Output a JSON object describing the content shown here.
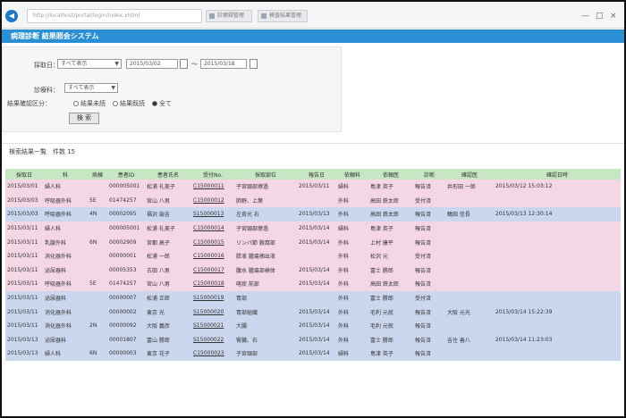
{
  "browser": {
    "url": "http://localhost/portal/login/index.xhtml",
    "tabs": [
      {
        "label": "診療録管理"
      },
      {
        "label": "検査結果管理"
      }
    ],
    "minimize": "—",
    "maximize": "□",
    "close": "×"
  },
  "app": {
    "title": "病理診断 結果照会システム"
  },
  "search": {
    "dept_label": "診療科：",
    "dept_value": "すべて表示",
    "date_label": "採取日：",
    "date_option": "すべて表示",
    "date_from": "2015/03/02",
    "date_to": "2015/03/18",
    "tilde": "～",
    "confirm_label": "結果確認区分：",
    "radio_unconfirmed": "結果未読",
    "radio_confirmed": "結果既読",
    "radio_all": "全て",
    "search_button": "検 索"
  },
  "results": {
    "title": "検索結果一覧　件数 15",
    "headers": [
      "採取日",
      "科",
      "病棟",
      "患者ID",
      "患者氏名",
      "受付No.",
      "採取部位",
      "報告日",
      "依頼科",
      "依頼医",
      "医師",
      "診断",
      "確認医",
      "確認日時"
    ],
    "rows": [
      {
        "color": "pink",
        "cells": [
          "2015/03/01",
          "婦人科",
          "",
          "000005001",
          "松浦 礼美子",
          "C15000011",
          "子宮頸部擦過",
          "2015/03/11",
          "婦科",
          "島津 英子",
          "報告済",
          "井形田 一郎",
          "2015/03/12 15:03:12"
        ]
      },
      {
        "color": "pink",
        "cells": [
          "2015/03/03",
          "呼吸器外科",
          "5E",
          "01474257",
          "宮山 八男",
          "C15000012",
          "肺野、上葉",
          "",
          "外科",
          "高田 鉄太郎",
          "受付済",
          "",
          ""
        ]
      },
      {
        "color": "blue",
        "cells": [
          "2015/03/03",
          "呼吸器外科",
          "4N",
          "00002095",
          "福沢 諭吉",
          "S15000013",
          "左背光 右",
          "2015/03/13",
          "外科",
          "高田 鉄太郎",
          "報告済",
          "鶴田 信長",
          "2015/03/13 12:30:14"
        ]
      },
      {
        "color": "pink",
        "cells": [
          "2015/03/11",
          "婦人科",
          "",
          "000005001",
          "松浦 礼美子",
          "C15000014",
          "子宮頸部擦過",
          "2015/03/14",
          "婦科",
          "島津 英子",
          "報告済",
          "",
          ""
        ]
      },
      {
        "color": "pink",
        "cells": [
          "2015/03/11",
          "乳腺外科",
          "6N",
          "00002909",
          "宮都 高子",
          "C15000015",
          "リンパ節 腋窩部",
          "2015/03/14",
          "外科",
          "上村 康平",
          "報告済",
          "",
          ""
        ]
      },
      {
        "color": "pink",
        "cells": [
          "2015/03/11",
          "消化器外科",
          "",
          "00000001",
          "松浦 一郎",
          "C15000016",
          "膵液 腫瘍摘出液",
          "",
          "外科",
          "松沢 元",
          "受付済",
          "",
          ""
        ]
      },
      {
        "color": "pink",
        "cells": [
          "2015/03/11",
          "泌尿器科",
          "",
          "00005353",
          "古田 八男",
          "C15000017",
          "腹水 腫瘍部検体",
          "2015/03/14",
          "外科",
          "富士 勝郎",
          "報告済",
          "",
          ""
        ]
      },
      {
        "color": "pink",
        "cells": [
          "2015/03/11",
          "呼吸器外科",
          "5E",
          "01474257",
          "宮山 八男",
          "C15000018",
          "喀痰 前部",
          "2015/03/14",
          "外科",
          "高田 鉄太郎",
          "報告済",
          "",
          ""
        ]
      },
      {
        "color": "blue",
        "cells": [
          "2015/03/11",
          "泌尿器科",
          "",
          "00000007",
          "松浦 正郎",
          "S15000019",
          "胃部",
          "",
          "外科",
          "富士 勝郎",
          "受付済",
          "",
          ""
        ]
      },
      {
        "color": "blue",
        "cells": [
          "2015/03/11",
          "消化器外科",
          "",
          "00000002",
          "東京 光",
          "S15000020",
          "胃部組織",
          "2015/03/14",
          "外科",
          "毛利 元就",
          "報告済",
          "大阪 元光",
          "2015/03/14 15:22:39"
        ]
      },
      {
        "color": "blue",
        "cells": [
          "2015/03/11",
          "消化器外科",
          "2N",
          "00000092",
          "大阪 義彦",
          "S15000021",
          "大腸",
          "2015/03/14",
          "外科",
          "毛利 元就",
          "報告済",
          "",
          ""
        ]
      },
      {
        "color": "blue",
        "cells": [
          "2015/03/13",
          "泌尿器科",
          "",
          "00001807",
          "富山 勝郎",
          "S15000022",
          "腎臓、右",
          "2015/03/14",
          "外科",
          "富士 勝郎",
          "報告済",
          "吉住 善八",
          "2015/03/14 11:23:03"
        ]
      },
      {
        "color": "blue",
        "cells": [
          "2015/03/13",
          "婦人科",
          "6N",
          "00000003",
          "東京 花子",
          "C15000023",
          "子宮頸部",
          "2015/03/14",
          "婦科",
          "島津 英子",
          "報告済",
          "",
          ""
        ]
      }
    ]
  },
  "colors": {
    "header_blue": "#2b8fd6",
    "row_pink": "#f5d6e4",
    "row_blue": "#cbd7ef",
    "table_header_green": "#c7e6c4",
    "link_blue": "#3a55c8",
    "date_red": "#7a1f2e"
  },
  "icons": [
    "browser-nav-icon",
    "tab-page-icon",
    "calendar-icon"
  ]
}
